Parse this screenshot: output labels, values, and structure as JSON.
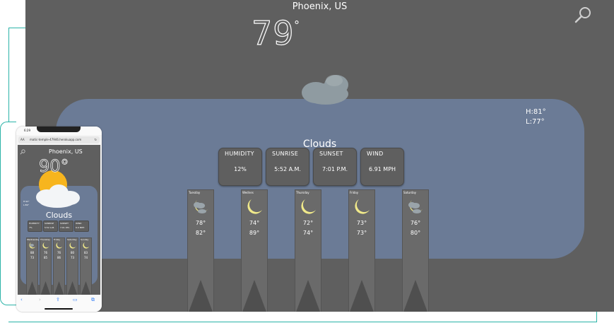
{
  "main": {
    "city": "Phoenix, US",
    "temperature": "79",
    "degree": "°",
    "high": "H:81°",
    "low": "L:77°",
    "condition": "Clouds",
    "stats": [
      {
        "label": "HUMIDITY",
        "value": "12%"
      },
      {
        "label": "SUNRISE",
        "value": "5:52 A.M."
      },
      {
        "label": "SUNSET",
        "value": "7:01 P.M."
      },
      {
        "label": "WIND",
        "value": "6.91 MPH"
      }
    ],
    "forecast": [
      {
        "day": "Tuesday",
        "icon": "moon-cloud-icon",
        "t1": "78°",
        "t2": "82°"
      },
      {
        "day": "Wednes",
        "icon": "moon-icon",
        "t1": "74°",
        "t2": "89°"
      },
      {
        "day": "Thursday",
        "icon": "moon-icon",
        "t1": "72°",
        "t2": "74°"
      },
      {
        "day": "Friday",
        "icon": "moon-icon",
        "t1": "73°",
        "t2": "73°"
      },
      {
        "day": "Saturday",
        "icon": "moon-cloud-icon",
        "t1": "76°",
        "t2": "80°"
      }
    ]
  },
  "phone": {
    "time": "6:29",
    "url_aa": "AA",
    "url": "matic-temple-47946.herokuapp.com",
    "city": "Phoenix, US",
    "temperature": "90°",
    "hilo": "H:92° L:89°",
    "condition": "Clouds",
    "stats": [
      {
        "label": "HUMIDITY",
        "value": "7%"
      },
      {
        "label": "SUNRISE",
        "value": "5:52 A.M."
      },
      {
        "label": "SUNSET",
        "value": "7:01 P.M."
      },
      {
        "label": "WIND",
        "value": "6.9 MPH"
      }
    ],
    "forecast": [
      {
        "day": "Wednesday",
        "t1": "88",
        "t2": "73"
      },
      {
        "day": "Thursday",
        "t1": "76",
        "t2": "85"
      },
      {
        "day": "Friday",
        "t1": "76",
        "t2": "86"
      },
      {
        "day": "Saturday",
        "t1": "80",
        "t2": "73"
      },
      {
        "day": "Sunday",
        "t1": "83",
        "t2": "74"
      }
    ]
  },
  "colors": {
    "background": "#5f5f5f",
    "band": "#6b7b96",
    "moon": "#d8d47a",
    "sun": "#f7b51e",
    "accent": "#2bb3a8"
  }
}
